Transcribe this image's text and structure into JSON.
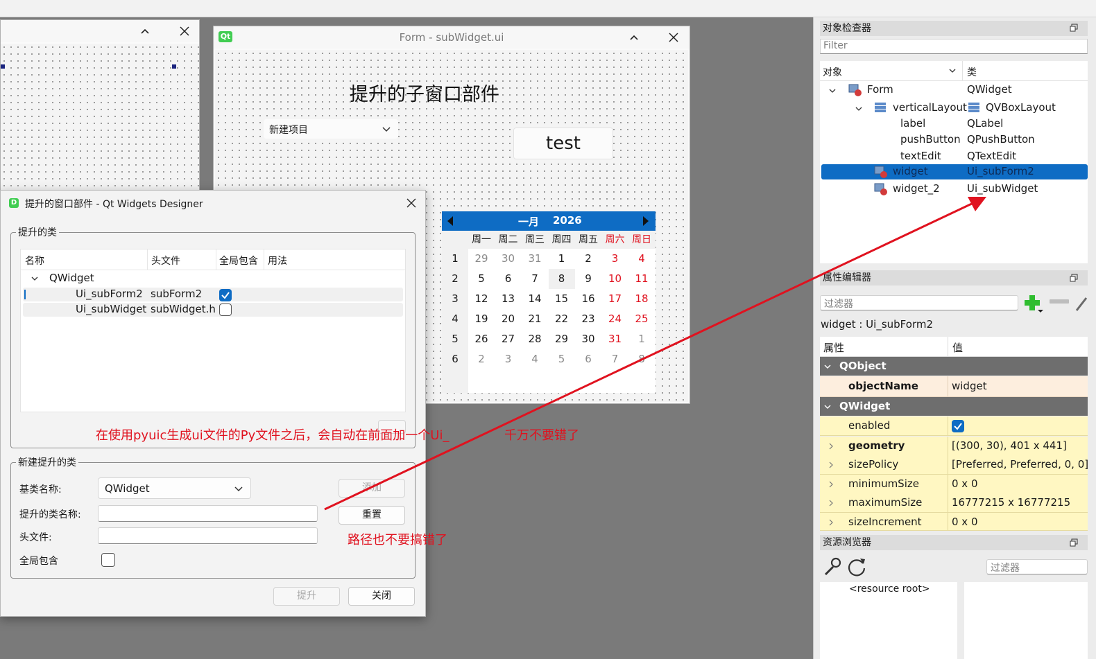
{
  "left_window": {},
  "form_window": {
    "title": "Form - subWidget.ui",
    "qt_badge": "Qt",
    "label_text": "提升的子窗口部件",
    "combo_value": "新建项目",
    "button_text": "test",
    "calendar": {
      "month": "一月",
      "year": "2026",
      "weekdays": [
        "周一",
        "周二",
        "周三",
        "周四",
        "周五",
        "周六",
        "周日"
      ],
      "weeks": [
        "1",
        "2",
        "3",
        "4",
        "5",
        "6"
      ],
      "days": [
        [
          "29",
          "30",
          "31",
          "1",
          "2",
          "3",
          "4"
        ],
        [
          "5",
          "6",
          "7",
          "8",
          "9",
          "10",
          "11"
        ],
        [
          "12",
          "13",
          "14",
          "15",
          "16",
          "17",
          "18"
        ],
        [
          "19",
          "20",
          "21",
          "22",
          "23",
          "24",
          "25"
        ],
        [
          "26",
          "27",
          "28",
          "29",
          "30",
          "31",
          "1"
        ],
        [
          "2",
          "3",
          "4",
          "5",
          "6",
          "7",
          "8"
        ]
      ]
    }
  },
  "dialog": {
    "title": "提升的窗口部件 - Qt Widgets Designer",
    "promoted_group": "提升的类",
    "columns": [
      "名称",
      "头文件",
      "全局包含",
      "用法"
    ],
    "base_class": "QWidget",
    "rows": [
      {
        "name": "Ui_subForm2",
        "header": "subForm2",
        "global": true
      },
      {
        "name": "Ui_subWidget",
        "header": "subWidget.h",
        "global": false
      }
    ],
    "new_group": "新建提升的类",
    "base_label": "基类名称:",
    "base_value": "QWidget",
    "promoted_name_label": "提升的类名称:",
    "header_label": "头文件:",
    "global_label": "全局包含",
    "add_button": "添加",
    "reset_button": "重置",
    "promote_button": "提升",
    "close_button": "关闭"
  },
  "annotations": {
    "note1_a": "在使用pyuic生成ui文件的Py文件之后，会自动在前面加一个Ui_",
    "note1_b": "千万不要错了",
    "note2": "路径也不要搞错了",
    "color": "#e0121f"
  },
  "object_inspector": {
    "title": "对象检查器",
    "filter_placeholder": "Filter",
    "col_object": "对象",
    "col_class": "类",
    "items": [
      {
        "name": "Form",
        "cls": "QWidget"
      },
      {
        "name": "verticalLayout",
        "cls": "QVBoxLayout"
      },
      {
        "name": "label",
        "cls": "QLabel"
      },
      {
        "name": "pushButton",
        "cls": "QPushButton"
      },
      {
        "name": "textEdit",
        "cls": "QTextEdit"
      },
      {
        "name": "widget",
        "cls": "Ui_subForm2"
      },
      {
        "name": "widget_2",
        "cls": "Ui_subWidget"
      }
    ]
  },
  "property_editor": {
    "title": "属性编辑器",
    "filter_placeholder": "过滤器",
    "context": "widget : Ui_subForm2",
    "col_prop": "属性",
    "col_value": "值",
    "group_qobject": "QObject",
    "group_qwidget": "QWidget",
    "props": [
      {
        "name": "objectName",
        "value": "widget"
      },
      {
        "name": "enabled",
        "value": ""
      },
      {
        "name": "geometry",
        "value": "[(300, 30), 401 x 441]"
      },
      {
        "name": "sizePolicy",
        "value": "[Preferred, Preferred, 0, 0]"
      },
      {
        "name": "minimumSize",
        "value": "0 x 0"
      },
      {
        "name": "maximumSize",
        "value": "16777215 x 16777215"
      },
      {
        "name": "sizeIncrement",
        "value": "0 x 0"
      }
    ]
  },
  "resource_browser": {
    "title": "资源浏览器",
    "filter_placeholder": "过滤器",
    "root": "<resource root>"
  },
  "colors": {
    "selection": "#0e6cc4",
    "calendar_header": "#0e6cc4",
    "mdi_bg": "#7a7a7a"
  }
}
